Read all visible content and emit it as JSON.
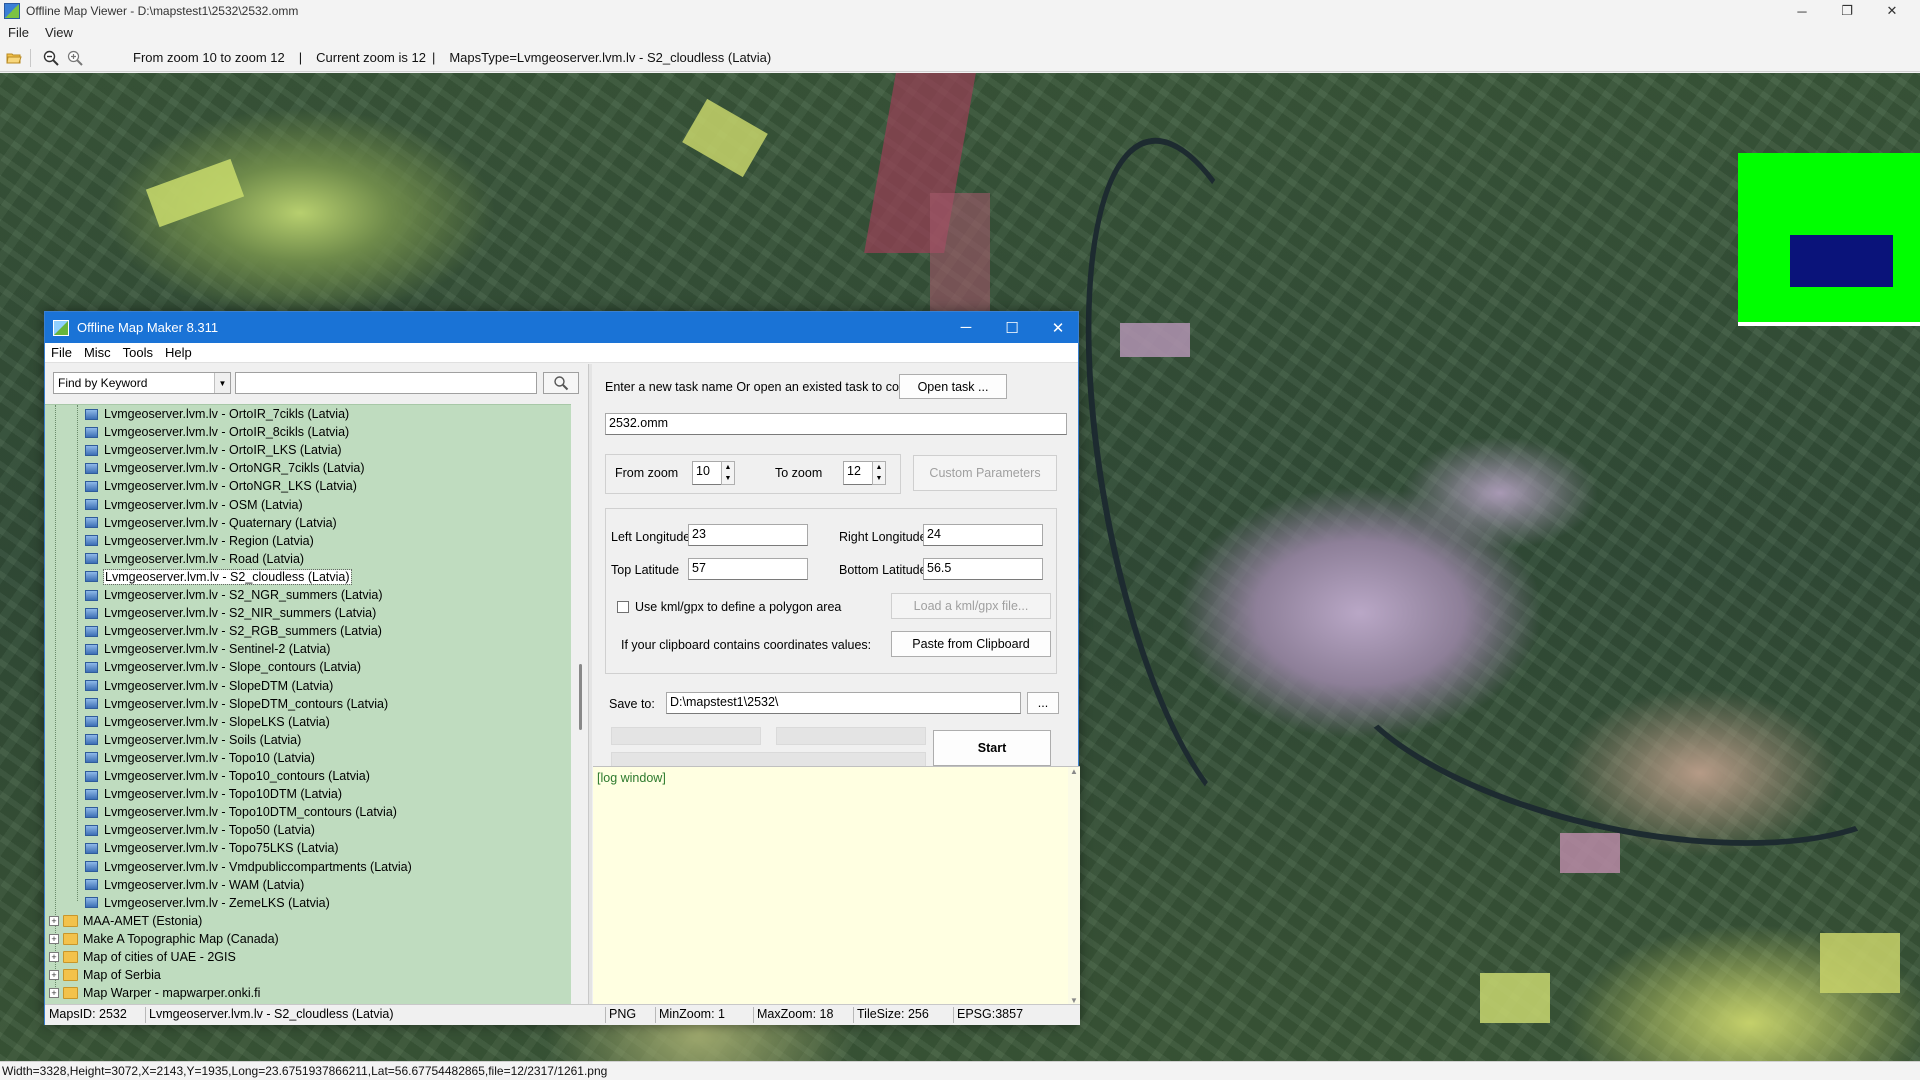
{
  "viewer": {
    "title": "Offline Map Viewer - D:\\mapstest1\\2532\\2532.omm",
    "menu": [
      "File",
      "View"
    ],
    "toolbar": {
      "zoom_range": "From zoom 10 to zoom 12",
      "current_zoom": "Current zoom is 12",
      "maps_type": "MapsType=Lvmgeoserver.lvm.lv - S2_cloudless (Latvia)",
      "separator": "|"
    },
    "status": "Width=3328,Height=3072,X=2143,Y=1935,Long=23.6751937866211,Lat=56.67754482865,file=12/2317/1261.png",
    "window_controls": {
      "minimize": "─",
      "maximize": "❐",
      "close": "✕"
    }
  },
  "dialog": {
    "title": "Offline Map Maker 8.311",
    "window_controls": {
      "minimize": "─",
      "maximize": "☐",
      "close": "✕"
    },
    "menu": [
      "File",
      "Misc",
      "Tools",
      "Help"
    ],
    "search": {
      "mode": "Find by Keyword",
      "value": ""
    },
    "tree": {
      "leaves": [
        "Lvmgeoserver.lvm.lv - OrtoIR_7cikls (Latvia)",
        "Lvmgeoserver.lvm.lv - OrtoIR_8cikls (Latvia)",
        "Lvmgeoserver.lvm.lv - OrtoIR_LKS (Latvia)",
        "Lvmgeoserver.lvm.lv - OrtoNGR_7cikls (Latvia)",
        "Lvmgeoserver.lvm.lv - OrtoNGR_LKS (Latvia)",
        "Lvmgeoserver.lvm.lv - OSM (Latvia)",
        "Lvmgeoserver.lvm.lv - Quaternary (Latvia)",
        "Lvmgeoserver.lvm.lv - Region (Latvia)",
        "Lvmgeoserver.lvm.lv - Road (Latvia)",
        "Lvmgeoserver.lvm.lv - S2_cloudless (Latvia)",
        "Lvmgeoserver.lvm.lv - S2_NGR_summers (Latvia)",
        "Lvmgeoserver.lvm.lv - S2_NIR_summers (Latvia)",
        "Lvmgeoserver.lvm.lv - S2_RGB_summers (Latvia)",
        "Lvmgeoserver.lvm.lv - Sentinel-2 (Latvia)",
        "Lvmgeoserver.lvm.lv - Slope_contours (Latvia)",
        "Lvmgeoserver.lvm.lv - SlopeDTM (Latvia)",
        "Lvmgeoserver.lvm.lv - SlopeDTM_contours (Latvia)",
        "Lvmgeoserver.lvm.lv - SlopeLKS (Latvia)",
        "Lvmgeoserver.lvm.lv - Soils (Latvia)",
        "Lvmgeoserver.lvm.lv - Topo10 (Latvia)",
        "Lvmgeoserver.lvm.lv - Topo10_contours (Latvia)",
        "Lvmgeoserver.lvm.lv - Topo10DTM (Latvia)",
        "Lvmgeoserver.lvm.lv - Topo10DTM_contours (Latvia)",
        "Lvmgeoserver.lvm.lv - Topo50 (Latvia)",
        "Lvmgeoserver.lvm.lv - Topo75LKS (Latvia)",
        "Lvmgeoserver.lvm.lv - Vmdpubliccompartments (Latvia)",
        "Lvmgeoserver.lvm.lv - WAM (Latvia)",
        "Lvmgeoserver.lvm.lv - ZemeLKS (Latvia)"
      ],
      "selected_leaf": "Lvmgeoserver.lvm.lv - S2_cloudless (Latvia)",
      "folders": [
        "MAA-AMET (Estonia)",
        "Make A Topographic Map (Canada)",
        "Map of cities of UAE - 2GIS",
        "Map of Serbia",
        "Map Warper - mapwarper.onki.fi"
      ]
    },
    "task": {
      "prompt": "Enter a new task name Or open an existed task to continue:",
      "open_button": "Open task ...",
      "task_name": "2532.omm"
    },
    "zoom": {
      "from_label": "From zoom",
      "from_value": "10",
      "to_label": "To zoom",
      "to_value": "12",
      "custom_button": "Custom Parameters"
    },
    "bounds": {
      "left_label": "Left Longitude",
      "left_value": "23",
      "right_label": "Right Longitude",
      "right_value": "24",
      "top_label": "Top Latitude",
      "top_value": "57",
      "bottom_label": "Bottom Latitude",
      "bottom_value": "56.5",
      "kml_label": "Use kml/gpx to define a polygon area",
      "kml_checked": false,
      "kml_button": "Load a kml/gpx file...",
      "clipboard_label": "If your clipboard contains coordinates values:",
      "clipboard_button": "Paste from Clipboard"
    },
    "save": {
      "label": "Save to:",
      "path": "D:\\mapstest1\\2532\\",
      "browse_button": "...",
      "start_button": "Start"
    },
    "log": {
      "text": "[log window]"
    },
    "status": {
      "maps_id": "MapsID: 2532",
      "map_name": "Lvmgeoserver.lvm.lv - S2_cloudless (Latvia)",
      "format": "PNG",
      "min_zoom": "MinZoom: 1",
      "max_zoom": "MaxZoom: 18",
      "tile_size": "TileSize: 256",
      "epsg": "EPSG:3857"
    }
  },
  "colors": {
    "dialog_title": "#1a73d6",
    "tree_bg": "#bfdcbf",
    "log_bg": "#ffffe1",
    "minimap_bg": "#00ff00",
    "minimap_viewport": "#0a137a"
  },
  "icons": {
    "open": "folder-open-icon",
    "zoom_out": "zoom-out-icon",
    "zoom_in": "zoom-in-icon",
    "search": "magnifier-icon"
  }
}
